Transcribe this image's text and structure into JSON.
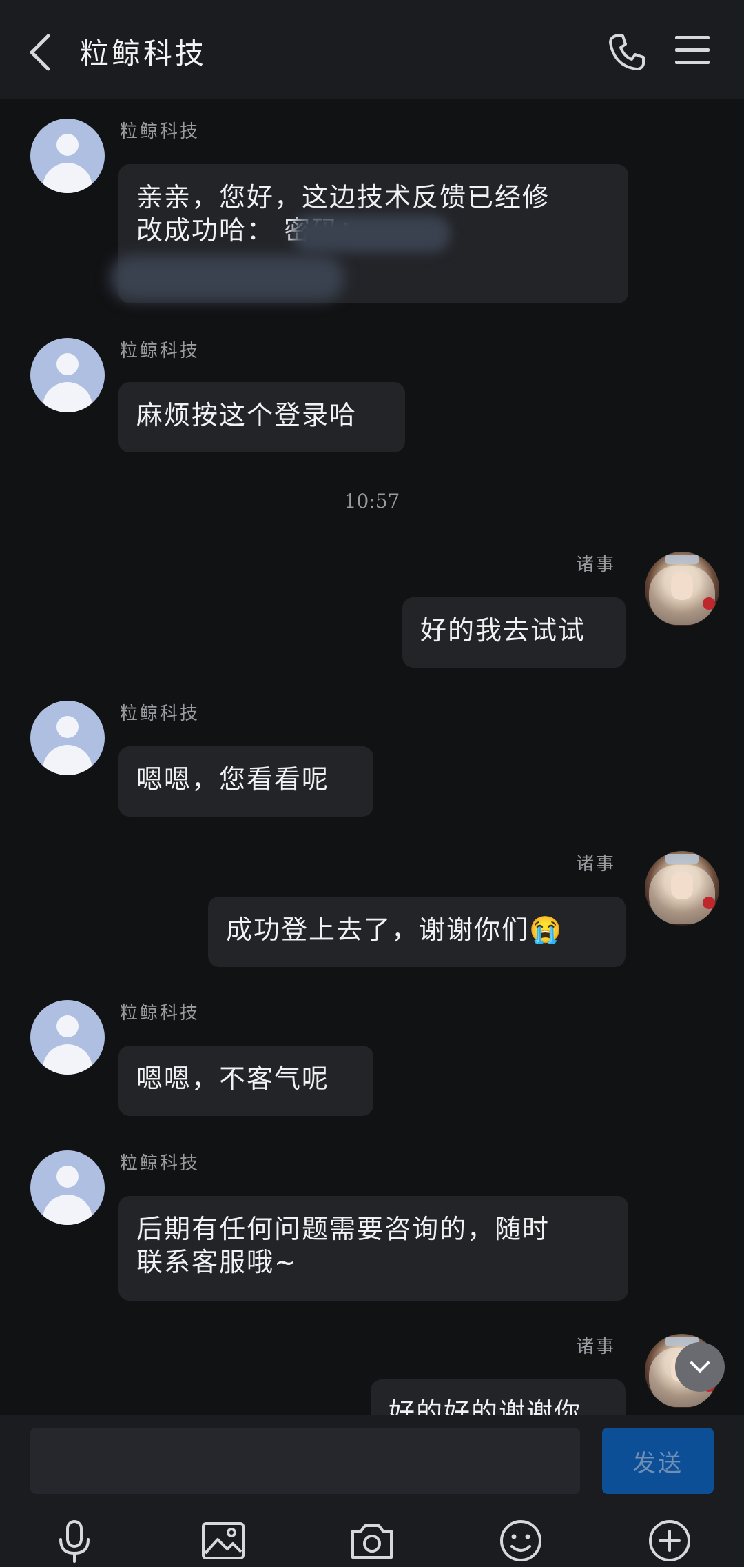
{
  "header": {
    "title": "粒鲸科技"
  },
  "messages": [
    {
      "side": "left",
      "sender": "粒鲸科技",
      "lines": [
        "亲亲，您好，这边技术反馈已经修",
        "改成功哈：                    密码："
      ]
    },
    {
      "side": "left",
      "sender": "粒鲸科技",
      "lines": [
        "麻烦按这个登录哈"
      ]
    },
    {
      "side": "right",
      "sender": "诸事",
      "lines": [
        "好的我去试试"
      ]
    },
    {
      "side": "left",
      "sender": "粒鲸科技",
      "lines": [
        "嗯嗯，您看看呢"
      ]
    },
    {
      "side": "right",
      "sender": "诸事",
      "lines": [
        "成功登上去了，谢谢你们😭"
      ]
    },
    {
      "side": "left",
      "sender": "粒鲸科技",
      "lines": [
        "嗯嗯，不客气呢"
      ]
    },
    {
      "side": "left",
      "sender": "粒鲸科技",
      "lines": [
        "后期有任何问题需要咨询的，随时",
        "联系客服哦~"
      ]
    },
    {
      "side": "right",
      "sender": "诸事",
      "lines": [
        "好的好的谢谢你"
      ]
    }
  ],
  "timestamp": "10:57",
  "input": {
    "placeholder": "",
    "send_label": "发送"
  },
  "toolbar": [
    "microphone-icon",
    "image-icon",
    "camera-icon",
    "emoji-icon",
    "plus-icon"
  ],
  "colors": {
    "background": "#111214",
    "bubble": "#232428",
    "send_button": "#0d4f97",
    "avatar_default": "#aebfe1"
  }
}
